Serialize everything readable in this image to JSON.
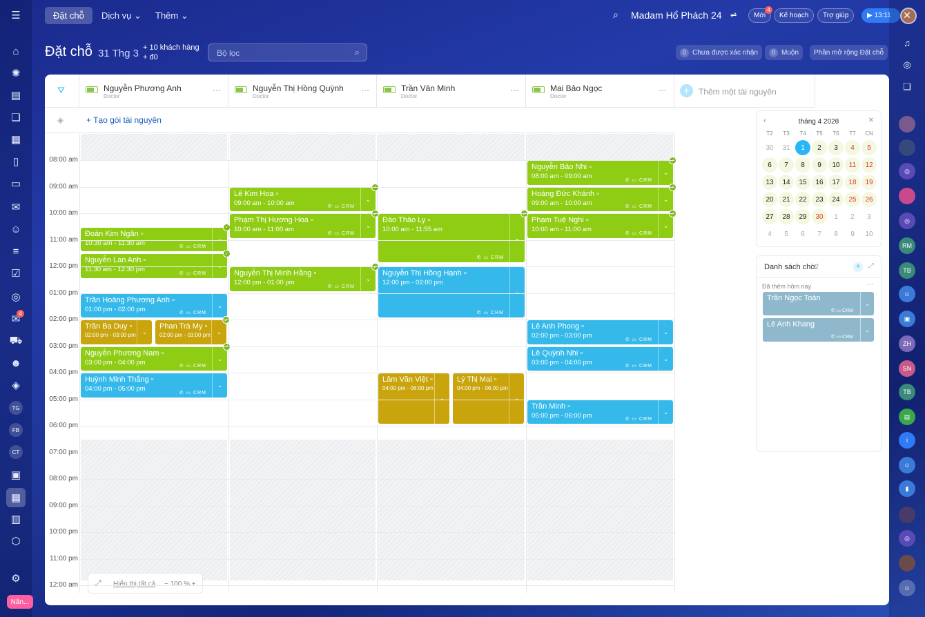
{
  "nav": {
    "booking": "Đặt chỗ",
    "services": "Dịch vụ ⌄",
    "more": "Thêm ⌄"
  },
  "company": "Madam Hổ Phách 24",
  "new_label": "Mới",
  "new_badge": "4",
  "plan_label": "Kế hoạch",
  "help_label": "Trợ giúp",
  "time": "▶ 13:11",
  "page": {
    "title": "Đặt chỗ",
    "date": "31 Thg 3",
    "add_clients": "+ 10 khách hàng",
    "add_money": "+ đ0",
    "filter_placeholder": "Bộ lọc",
    "unconfirmed": "Chưa được xác nhận",
    "unconfirmed_count": "0",
    "late": "Muộn",
    "late_count": "0",
    "extensions": "Phần mở rộng Đặt chỗ"
  },
  "left_badge": "4",
  "left_avatars": [
    "TG",
    "FB",
    "CT"
  ],
  "upgrade": "Nân...",
  "right_avatars": [
    "RM",
    "TB",
    "ZH",
    "SN",
    "TB"
  ],
  "resources": [
    {
      "name": "Nguyễn Phương Anh",
      "role": "Doctor"
    },
    {
      "name": "Nguyễn Thị Hồng Quỳnh",
      "role": "Doctor"
    },
    {
      "name": "Trần Văn Minh",
      "role": "Doctor"
    },
    {
      "name": "Mai Bảo Ngọc",
      "role": "Doctor"
    }
  ],
  "add_resource": "Thêm một tài nguyên",
  "create_package": "+ Tạo gói tài nguyên",
  "times": [
    "08:00 am",
    "09:00 am",
    "10:00 am",
    "11:00 am",
    "12:00 pm",
    "01:00 pm",
    "02:00 pm",
    "03:00 pm",
    "04:00 pm",
    "05:00 pm",
    "06:00 pm",
    "07:00 pm",
    "08:00 pm",
    "09:00 pm",
    "10:00 pm",
    "11:00 pm",
    "12:00 am"
  ],
  "events": [
    {
      "col": 0,
      "start": 10.5,
      "end": 11.5,
      "w": 1,
      "o": 0,
      "c": "g",
      "name": "Đoàn Kim Ngân",
      "time": "10:30 am - 11:30 am",
      "ok": true
    },
    {
      "col": 0,
      "start": 11.5,
      "end": 12.5,
      "w": 1,
      "o": 0,
      "c": "g",
      "name": "Nguyễn Lan Anh",
      "time": "11:30 am - 12:30 pm",
      "ok": true
    },
    {
      "col": 0,
      "start": 13,
      "end": 14,
      "w": 1,
      "o": 0,
      "c": "b",
      "name": "Trần Hoàng Phương Anh",
      "time": "01:00 pm - 02:00 pm",
      "ok": false
    },
    {
      "col": 0,
      "start": 14,
      "end": 15,
      "w": 0.5,
      "o": 0,
      "c": "y",
      "name": "Trần Ba Duy",
      "time": "02:00 pm - 03:00 pm",
      "ok": false
    },
    {
      "col": 0,
      "start": 14,
      "end": 15,
      "w": 0.5,
      "o": 0.5,
      "c": "y",
      "name": "Phan Trà My",
      "time": "02:00 pm - 03:00 pm",
      "ok": true
    },
    {
      "col": 0,
      "start": 15,
      "end": 16,
      "w": 1,
      "o": 0,
      "c": "g",
      "name": "Nguyễn Phương Nam",
      "time": "03:00 pm - 04:00 pm",
      "ok": true
    },
    {
      "col": 0,
      "start": 16,
      "end": 17,
      "w": 1,
      "o": 0,
      "c": "b",
      "name": "Huỳnh Minh Thắng",
      "time": "04:00 pm - 05:00 pm",
      "ok": false
    },
    {
      "col": 1,
      "start": 9,
      "end": 10,
      "w": 1,
      "o": 0,
      "c": "g",
      "name": "Lê Kim Hoa",
      "time": "09:00 am - 10:00 am",
      "ok": true
    },
    {
      "col": 1,
      "start": 10,
      "end": 11,
      "w": 1,
      "o": 0,
      "c": "g",
      "name": "Phạm Thị Hương Hoa",
      "time": "10:00 am - 11:00 am",
      "ok": true
    },
    {
      "col": 1,
      "start": 12,
      "end": 13,
      "w": 1,
      "o": 0,
      "c": "g",
      "name": "Nguyễn Thị Minh Hằng",
      "time": "12:00 pm - 01:00 pm",
      "ok": true
    },
    {
      "col": 2,
      "start": 10,
      "end": 11.92,
      "w": 1,
      "o": 0,
      "c": "g",
      "name": "Đào Thảo Ly",
      "time": "10:00 am - 11:55 am",
      "ok": true
    },
    {
      "col": 2,
      "start": 12,
      "end": 14,
      "w": 1,
      "o": 0,
      "c": "b",
      "name": "Nguyễn Thị Hồng Hạnh",
      "time": "12:00 pm - 02:00 pm",
      "ok": false
    },
    {
      "col": 2,
      "start": 16,
      "end": 18,
      "w": 0.5,
      "o": 0,
      "c": "y",
      "name": "Lâm Văn Việt",
      "time": "04:00 pm - 06:00 pm",
      "ok": false
    },
    {
      "col": 2,
      "start": 16,
      "end": 18,
      "w": 0.5,
      "o": 0.5,
      "c": "y",
      "name": "Lý Thị Mai",
      "time": "04:00 pm - 06:00 pm",
      "ok": false
    },
    {
      "col": 3,
      "start": 8,
      "end": 9,
      "w": 1,
      "o": 0,
      "c": "g",
      "name": "Nguyễn Bảo Nhi",
      "time": "08:00 am - 09:00 am",
      "ok": true
    },
    {
      "col": 3,
      "start": 9,
      "end": 10,
      "w": 1,
      "o": 0,
      "c": "g",
      "name": "Hoàng Đức Khánh",
      "time": "09:00 am - 10:00 am",
      "ok": true
    },
    {
      "col": 3,
      "start": 10,
      "end": 11,
      "w": 1,
      "o": 0,
      "c": "g",
      "name": "Phạm Tuệ Nghi",
      "time": "10:00 am - 11:00 am",
      "ok": true
    },
    {
      "col": 3,
      "start": 14,
      "end": 15,
      "w": 1,
      "o": 0,
      "c": "b",
      "name": "Lê Anh Phong",
      "time": "02:00 pm - 03:00 pm",
      "ok": false
    },
    {
      "col": 3,
      "start": 15,
      "end": 16,
      "w": 1,
      "o": 0,
      "c": "b",
      "name": "Lê Quỳnh Nhi",
      "time": "03:00 pm - 04:00 pm",
      "ok": false
    },
    {
      "col": 3,
      "start": 17,
      "end": 18,
      "w": 1,
      "o": 0,
      "c": "b",
      "name": "Trần Minh",
      "time": "05:00 pm - 06:00 pm",
      "ok": false
    }
  ],
  "icons_text": "✆ ▭ CRM",
  "calendar": {
    "month": "tháng 4 2026",
    "weekdays": [
      "T2",
      "T3",
      "T4",
      "T5",
      "T6",
      "T7",
      "CN"
    ],
    "days": [
      [
        "30",
        "31",
        "1",
        "2",
        "3",
        "4",
        "5"
      ],
      [
        "6",
        "7",
        "8",
        "9",
        "10",
        "11",
        "12"
      ],
      [
        "13",
        "14",
        "15",
        "16",
        "17",
        "18",
        "19"
      ],
      [
        "20",
        "21",
        "22",
        "23",
        "24",
        "25",
        "26"
      ],
      [
        "27",
        "28",
        "29",
        "30",
        "1",
        "2",
        "3"
      ],
      [
        "4",
        "5",
        "6",
        "7",
        "8",
        "9",
        "10"
      ]
    ],
    "today_color": "#29b6f6"
  },
  "waitlist": {
    "title": "Danh sách chờ",
    "count": "2",
    "added_today": "Đã thêm hôm nay",
    "items": [
      {
        "name": "Trần Ngọc Toàn"
      },
      {
        "name": "Lê Anh Khang"
      }
    ]
  },
  "zoom": {
    "show_all": "Hiển thị tất cả",
    "level": "− 100 % +"
  }
}
